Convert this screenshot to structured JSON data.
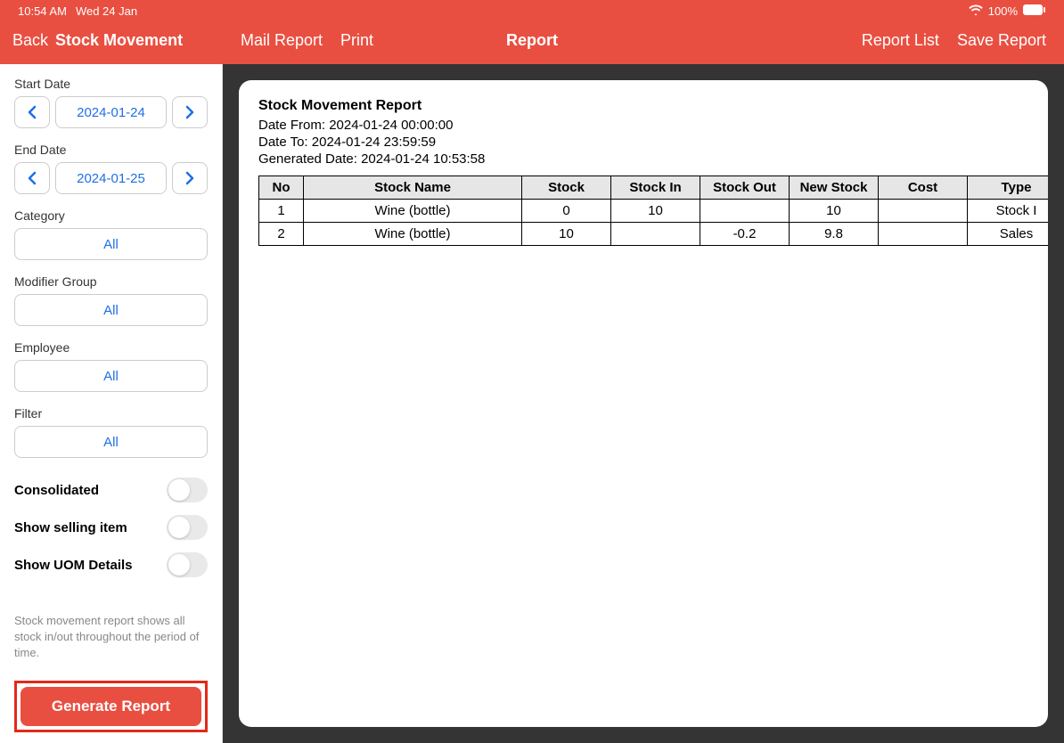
{
  "status": {
    "time": "10:54 AM",
    "date": "Wed 24 Jan",
    "battery": "100%"
  },
  "header": {
    "back": "Back",
    "title": "Stock Movement",
    "mail": "Mail Report",
    "print": "Print",
    "center": "Report",
    "list": "Report List",
    "save": "Save Report"
  },
  "sidebar": {
    "startDateLabel": "Start Date",
    "startDate": "2024-01-24",
    "endDateLabel": "End Date",
    "endDate": "2024-01-25",
    "categoryLabel": "Category",
    "categoryValue": "All",
    "modifierLabel": "Modifier Group",
    "modifierValue": "All",
    "employeeLabel": "Employee",
    "employeeValue": "All",
    "filterLabel": "Filter",
    "filterValue": "All",
    "toggle1": "Consolidated",
    "toggle2": "Show selling item",
    "toggle3": "Show UOM Details",
    "description": "Stock movement report shows all stock in/out throughout the period of time.",
    "generate": "Generate Report"
  },
  "report": {
    "title": "Stock Movement Report",
    "dateFromLabel": "Date From: ",
    "dateFrom": "2024-01-24 00:00:00",
    "dateToLabel": "Date To: ",
    "dateTo": "2024-01-24 23:59:59",
    "generatedLabel": "Generated Date: ",
    "generated": "2024-01-24 10:53:58",
    "headers": {
      "no": "No",
      "name": "Stock Name",
      "stock": "Stock",
      "in": "Stock In",
      "out": "Stock Out",
      "new": "New Stock",
      "cost": "Cost",
      "type": "Type"
    },
    "rows": [
      {
        "no": "1",
        "name": "Wine (bottle)",
        "stock": "0",
        "in": "10",
        "out": "",
        "new": "10",
        "cost": "",
        "type": "Stock I"
      },
      {
        "no": "2",
        "name": "Wine (bottle)",
        "stock": "10",
        "in": "",
        "out": "-0.2",
        "new": "9.8",
        "cost": "",
        "type": "Sales"
      }
    ]
  }
}
